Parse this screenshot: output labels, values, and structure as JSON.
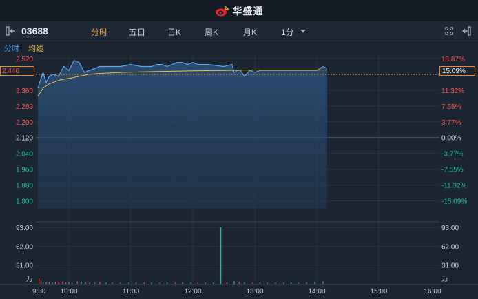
{
  "app": {
    "name": "华盛通"
  },
  "toolbar": {
    "code": "03688",
    "tabs": [
      {
        "label": "分时",
        "active": true
      },
      {
        "label": "五日",
        "active": false
      },
      {
        "label": "日K",
        "active": false
      },
      {
        "label": "周K",
        "active": false
      },
      {
        "label": "月K",
        "active": false
      },
      {
        "label": "1分",
        "active": false
      }
    ]
  },
  "legend": {
    "time_label": "分时",
    "avg_label": "均线"
  },
  "colors": {
    "up": "#ff5252",
    "down": "#22c38e",
    "price_line": "#5fa8f0",
    "avg_line": "#f2c14a",
    "accent": "#f4a23c"
  },
  "current": {
    "price": "2.440",
    "pct": "15.09%"
  },
  "chart_data": {
    "type": "line",
    "prev_close": 2.12,
    "price_axis": {
      "ticks": [
        "2.520",
        "2.440",
        "2.360",
        "2.280",
        "2.200",
        "2.120",
        "2.040",
        "1.960",
        "1.880",
        "1.800"
      ],
      "ylim": [
        1.76,
        2.52
      ]
    },
    "pct_axis": {
      "ticks": [
        "18.87%",
        "15.09%",
        "11.32%",
        "7.55%",
        "3.77%",
        "0.00%",
        "-3.77%",
        "-7.55%",
        "-11.32%",
        "-15.09%"
      ]
    },
    "time_axis": {
      "ticks": [
        "9:30",
        "10:00",
        "11:00",
        "12:00",
        "13:00",
        "14:00",
        "15:00",
        "16:00"
      ]
    },
    "volume_axis": {
      "ticks": [
        "93.00",
        "62.00",
        "31.00"
      ],
      "unit": "万",
      "ylim": [
        0,
        93
      ]
    },
    "series": [
      {
        "name": "分时",
        "x": [
          0,
          5,
          8,
          11,
          15,
          20,
          25,
          30,
          35,
          40,
          45,
          55,
          60,
          70,
          80,
          90,
          100,
          110,
          115,
          120,
          125,
          130,
          135,
          140,
          145,
          150,
          155,
          165,
          180,
          188,
          190,
          193,
          196,
          200,
          205,
          210,
          215,
          220,
          230,
          240,
          250,
          260,
          270,
          276,
          280
        ],
        "y": [
          2.37,
          2.45,
          2.4,
          2.43,
          2.44,
          2.43,
          2.48,
          2.46,
          2.51,
          2.5,
          2.45,
          2.47,
          2.48,
          2.48,
          2.48,
          2.49,
          2.48,
          2.48,
          2.49,
          2.49,
          2.48,
          2.49,
          2.5,
          2.5,
          2.49,
          2.5,
          2.49,
          2.49,
          2.48,
          2.49,
          2.45,
          2.46,
          2.46,
          2.43,
          2.46,
          2.45,
          2.46,
          2.46,
          2.46,
          2.46,
          2.46,
          2.46,
          2.46,
          2.48,
          2.47
        ]
      },
      {
        "name": "均线",
        "x": [
          0,
          5,
          10,
          20,
          30,
          40,
          50,
          60,
          80,
          100,
          120,
          150,
          180,
          200,
          230,
          260,
          280
        ],
        "y": [
          2.33,
          2.37,
          2.39,
          2.41,
          2.42,
          2.43,
          2.44,
          2.445,
          2.45,
          2.453,
          2.455,
          2.458,
          2.46,
          2.462,
          2.462,
          2.462,
          2.462
        ]
      }
    ],
    "volume": [
      {
        "t": 1,
        "v": 9,
        "dir": "up"
      },
      {
        "t": 3,
        "v": 5,
        "dir": "up"
      },
      {
        "t": 5,
        "v": 4,
        "dir": "down"
      },
      {
        "t": 8,
        "v": 3,
        "dir": "up"
      },
      {
        "t": 11,
        "v": 3,
        "dir": "up"
      },
      {
        "t": 14,
        "v": 2,
        "dir": "down"
      },
      {
        "t": 17,
        "v": 3,
        "dir": "up"
      },
      {
        "t": 20,
        "v": 2,
        "dir": "up"
      },
      {
        "t": 24,
        "v": 4,
        "dir": "up"
      },
      {
        "t": 27,
        "v": 2,
        "dir": "down"
      },
      {
        "t": 30,
        "v": 3,
        "dir": "up"
      },
      {
        "t": 33,
        "v": 2,
        "dir": "down"
      },
      {
        "t": 38,
        "v": 4,
        "dir": "up"
      },
      {
        "t": 42,
        "v": 3,
        "dir": "down"
      },
      {
        "t": 46,
        "v": 3,
        "dir": "up"
      },
      {
        "t": 50,
        "v": 2,
        "dir": "down"
      },
      {
        "t": 55,
        "v": 2,
        "dir": "up"
      },
      {
        "t": 60,
        "v": 3,
        "dir": "up"
      },
      {
        "t": 66,
        "v": 2,
        "dir": "down"
      },
      {
        "t": 72,
        "v": 2,
        "dir": "up"
      },
      {
        "t": 80,
        "v": 2,
        "dir": "up"
      },
      {
        "t": 88,
        "v": 2,
        "dir": "down"
      },
      {
        "t": 95,
        "v": 2,
        "dir": "up"
      },
      {
        "t": 103,
        "v": 2,
        "dir": "up"
      },
      {
        "t": 110,
        "v": 2,
        "dir": "down"
      },
      {
        "t": 118,
        "v": 2,
        "dir": "up"
      },
      {
        "t": 125,
        "v": 2,
        "dir": "down"
      },
      {
        "t": 133,
        "v": 2,
        "dir": "up"
      },
      {
        "t": 140,
        "v": 2,
        "dir": "up"
      },
      {
        "t": 148,
        "v": 2,
        "dir": "down"
      },
      {
        "t": 155,
        "v": 2,
        "dir": "up"
      },
      {
        "t": 162,
        "v": 2,
        "dir": "up"
      },
      {
        "t": 170,
        "v": 2,
        "dir": "down"
      },
      {
        "t": 177,
        "v": 93,
        "dir": "down"
      },
      {
        "t": 183,
        "v": 2,
        "dir": "up"
      },
      {
        "t": 190,
        "v": 4,
        "dir": "down"
      },
      {
        "t": 195,
        "v": 3,
        "dir": "up"
      },
      {
        "t": 200,
        "v": 2,
        "dir": "down"
      },
      {
        "t": 208,
        "v": 2,
        "dir": "up"
      },
      {
        "t": 215,
        "v": 3,
        "dir": "up"
      },
      {
        "t": 222,
        "v": 2,
        "dir": "down"
      },
      {
        "t": 230,
        "v": 2,
        "dir": "up"
      },
      {
        "t": 238,
        "v": 2,
        "dir": "up"
      },
      {
        "t": 245,
        "v": 2,
        "dir": "down"
      },
      {
        "t": 252,
        "v": 2,
        "dir": "up"
      },
      {
        "t": 260,
        "v": 2,
        "dir": "up"
      },
      {
        "t": 268,
        "v": 3,
        "dir": "down"
      },
      {
        "t": 276,
        "v": 4,
        "dir": "up"
      }
    ],
    "grid": true
  }
}
